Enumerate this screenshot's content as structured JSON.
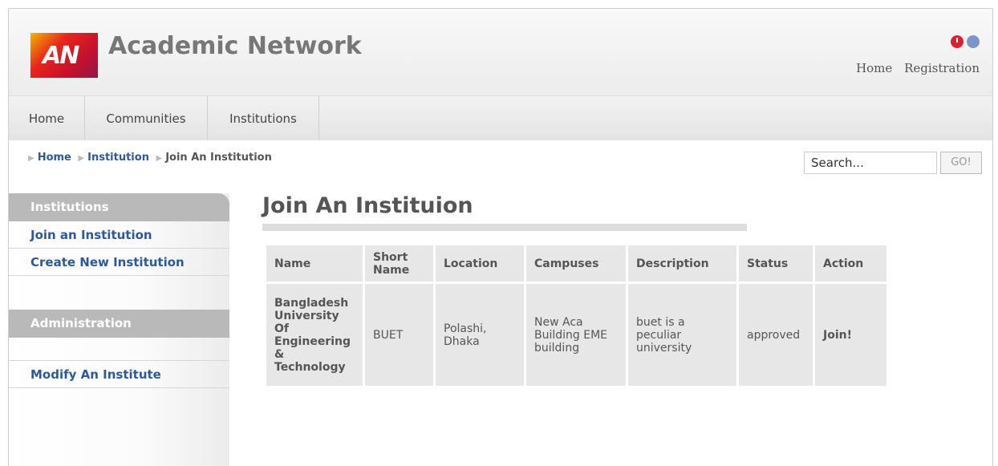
{
  "header": {
    "logo_text": "AN",
    "site_title": "Academic Network",
    "top_links": [
      "Home",
      "Registration"
    ],
    "status_icons": [
      "clock-icon",
      "globe-icon"
    ]
  },
  "nav": {
    "items": [
      "Home",
      "Communities",
      "Institutions"
    ]
  },
  "breadcrumb": {
    "items": [
      "Home",
      "Institution",
      "Join An Institution"
    ]
  },
  "search": {
    "value": "Search...",
    "button_label": "GO!"
  },
  "sidebar": {
    "section1_title": "Institutions",
    "section1_links": [
      "Join an Institution",
      "Create New Institution"
    ],
    "section2_title": "Administration",
    "section2_links": [
      "Modify An Institute"
    ]
  },
  "main": {
    "title": "Join An Instituion",
    "table": {
      "headers": [
        "Name",
        "Short Name",
        "Location",
        "Campuses",
        "Description",
        "Status",
        "Action"
      ],
      "rows": [
        {
          "name": "Bangladesh University Of Engineering & Technology",
          "short_name": "BUET",
          "location": "Polashi, Dhaka",
          "campuses": "New Aca Building EME building",
          "description": "buet is a peculiar university",
          "status": "approved",
          "action": "Join!"
        }
      ]
    }
  },
  "colors": {
    "link": "#2d5a96",
    "sidebar_header": "#b9b9b9",
    "table_cell": "#e7e7e7"
  }
}
